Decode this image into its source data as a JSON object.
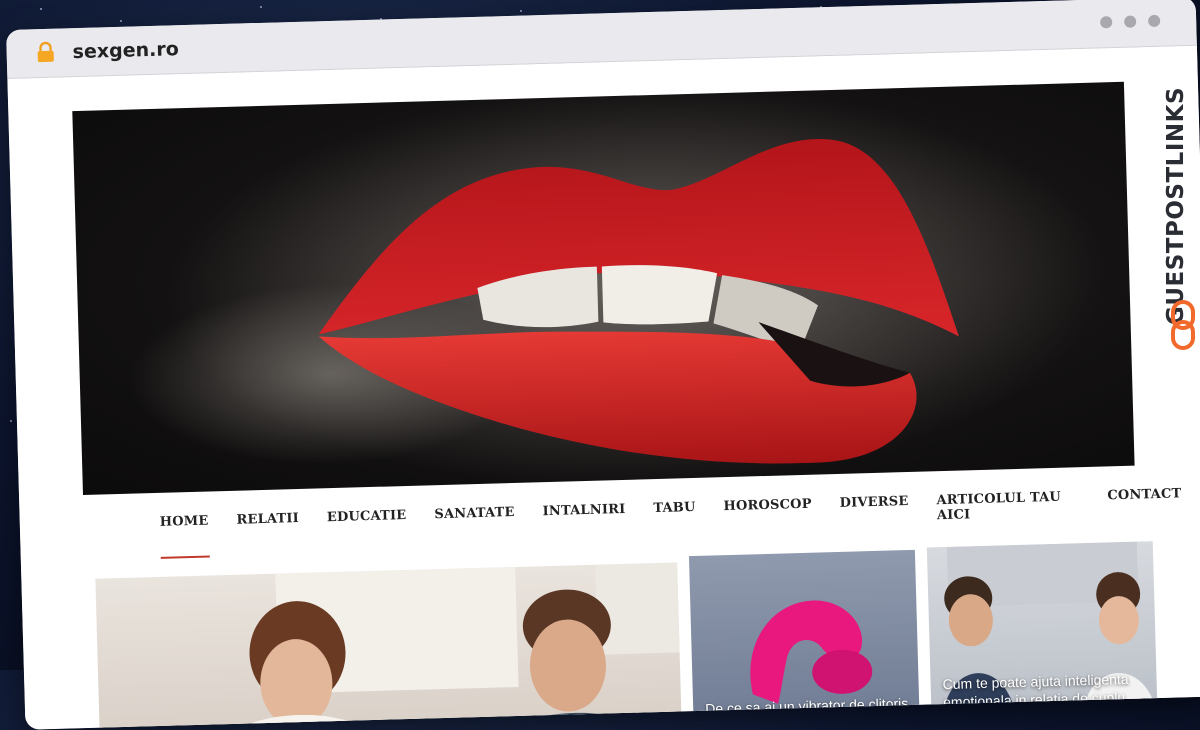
{
  "browser": {
    "url": "sexgen.ro"
  },
  "nav": {
    "items": [
      {
        "label": "HOME",
        "active": true
      },
      {
        "label": "RELATII"
      },
      {
        "label": "EDUCATIE"
      },
      {
        "label": "SANATATE"
      },
      {
        "label": "INTALNIRI"
      },
      {
        "label": "TABU"
      },
      {
        "label": "HOROSCOP"
      },
      {
        "label": "DIVERSE"
      },
      {
        "label": "ARTICOLUL TAU AICI"
      },
      {
        "label": "CONTACT"
      }
    ]
  },
  "cards": [
    {
      "caption": ""
    },
    {
      "caption": "De ce sa ai un vibrator de clitoris"
    },
    {
      "caption": "Cum te poate ajuta inteligenta emotionala in relatia de cuplu"
    }
  ],
  "badge": {
    "text": "GUESTPOSTLINKS",
    "icon": "chain-link-icon"
  },
  "colors": {
    "accent": "#c0392b",
    "badge_orange": "#f26a2b"
  }
}
